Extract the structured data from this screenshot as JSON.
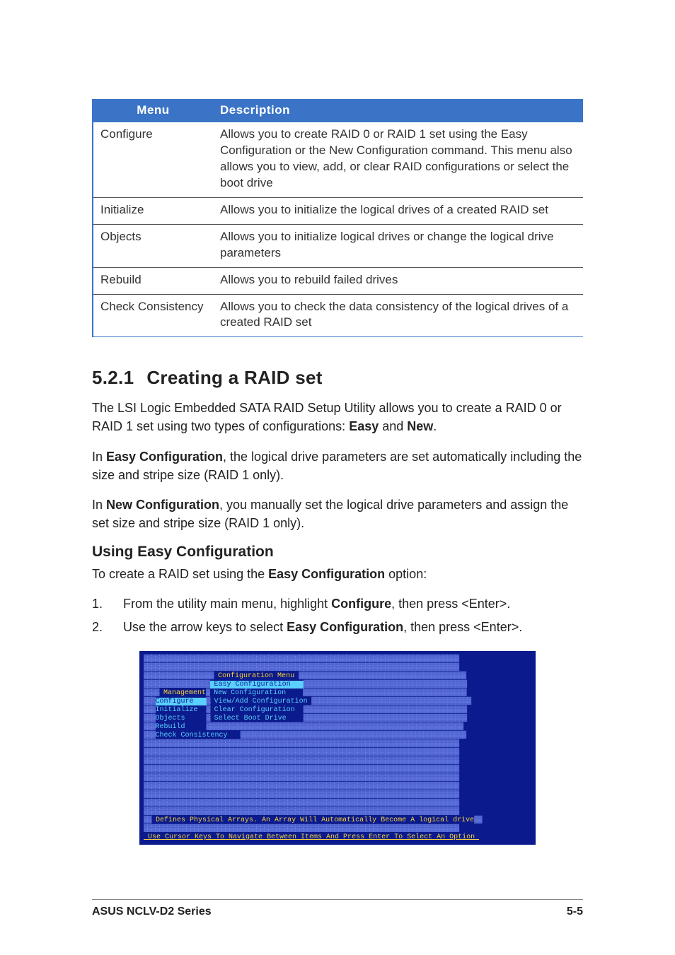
{
  "table": {
    "headers": [
      "Menu",
      "Description"
    ],
    "rows": [
      {
        "menu": "Configure",
        "desc": "Allows you to create RAID 0 or RAID 1 set using the Easy Configuration or the New Configuration command. This menu also allows you to view, add, or clear RAID configurations or select the boot drive"
      },
      {
        "menu": "Initialize",
        "desc": "Allows you to initialize the logical drives of a created RAID set"
      },
      {
        "menu": "Objects",
        "desc": "Allows you to initialize logical drives or change the logical drive parameters"
      },
      {
        "menu": "Rebuild",
        "desc": "Allows you to rebuild failed drives"
      },
      {
        "menu": "Check Consistency",
        "desc": "Allows you to check the data consistency of the logical drives of a created RAID set"
      }
    ]
  },
  "heading": {
    "num": "5.2.1",
    "title": "Creating a RAID set"
  },
  "para1a": "The LSI Logic Embedded SATA RAID Setup Utility allows you to create a RAID 0 or RAID 1 set using two types of configurations: ",
  "para1b_easy": "Easy",
  "para1c": " and ",
  "para1d_new": "New",
  "para1e": ".",
  "para2a": "In ",
  "para2b": "Easy Configuration",
  "para2c": ", the logical drive parameters are set automatically including the size and stripe size (RAID 1 only).",
  "para3a": "In ",
  "para3b": "New Configuration",
  "para3c": ", you manually set the logical drive parameters and assign the set size and stripe size (RAID 1 only).",
  "subheading": "Using Easy Configuration",
  "para4a": "To create a RAID set using the ",
  "para4b": "Easy Configuration",
  "para4c": " option:",
  "steps": [
    {
      "n": "1.",
      "a": "From the utility main menu, highlight ",
      "b": "Configure",
      "c": ", then press <Enter>."
    },
    {
      "n": "2.",
      "a": "Use the arrow keys to select ",
      "b": "Easy Configuration",
      "c": ", then press <Enter>."
    }
  ],
  "terminal": {
    "title": "Configuration Menu",
    "items_left": [
      "Management",
      "Configure",
      "Initialize",
      "Objects",
      "Rebuild",
      "Check Consistency"
    ],
    "submenu_hl": "Easy Configuration",
    "submenu": [
      "New Configuration",
      "View/Add Configuration",
      "Clear Configuration",
      "Select Boot Drive"
    ],
    "status": "Defines Physical Arrays. An Array Will Automatically Become A logical drive",
    "hint": "Use Cursor Keys To Navigate Between Items And Press Enter To Select An Option"
  },
  "footer": {
    "left": "ASUS NCLV-D2 Series",
    "right": "5-5"
  }
}
